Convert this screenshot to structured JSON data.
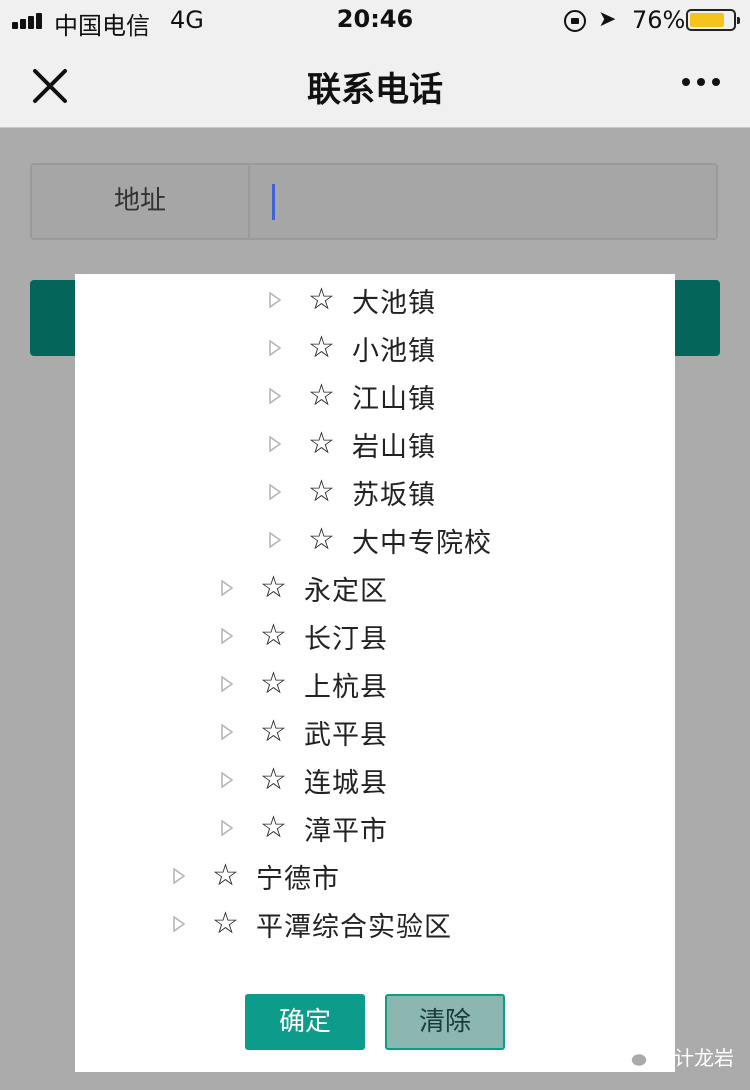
{
  "status_bar": {
    "carrier": "中国电信",
    "network": "4G",
    "time": "20:46",
    "battery": "76%",
    "battery_color": "#f4c41a",
    "icons": [
      "signal-icon",
      "orientation-lock-icon",
      "location-icon",
      "battery-icon"
    ]
  },
  "nav": {
    "title": "联系电话",
    "close_icon": "close-icon",
    "more_icon": "more-icon"
  },
  "form": {
    "address_label": "地址",
    "address_value": ""
  },
  "tree": {
    "items": [
      {
        "label": "大池镇",
        "level": 3
      },
      {
        "label": "小池镇",
        "level": 3
      },
      {
        "label": "江山镇",
        "level": 3
      },
      {
        "label": "岩山镇",
        "level": 3
      },
      {
        "label": "苏坂镇",
        "level": 3
      },
      {
        "label": "大中专院校",
        "level": 3
      },
      {
        "label": "永定区",
        "level": 2
      },
      {
        "label": "长汀县",
        "level": 2
      },
      {
        "label": "上杭县",
        "level": 2
      },
      {
        "label": "武平县",
        "level": 2
      },
      {
        "label": "连城县",
        "level": 2
      },
      {
        "label": "漳平市",
        "level": 2
      },
      {
        "label": "宁德市",
        "level": 1
      },
      {
        "label": "平潭综合实验区",
        "level": 1
      }
    ],
    "star_glyph": "☆"
  },
  "buttons": {
    "confirm": "确定",
    "clear": "清除"
  },
  "watermark": "卫计龙岩",
  "colors": {
    "teal": "#0d9b8c",
    "teal_dark": "#04665a"
  }
}
